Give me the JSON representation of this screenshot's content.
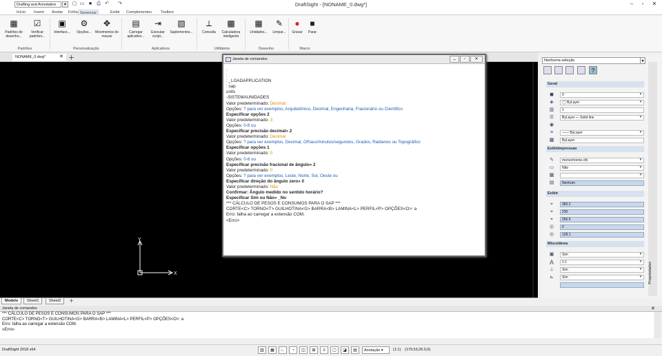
{
  "titlebar": {
    "workspace": "Drafting and Annotation",
    "title": "DraftSight - [NONAME_0.dwg*]",
    "qa_icons": [
      "new-icon",
      "open-icon",
      "save-icon",
      "print-icon",
      "undo-icon",
      "redo-icon"
    ]
  },
  "menu": {
    "tabs": [
      "Início",
      "Inserir",
      "Anotar",
      "Folha",
      "Gerenciar",
      "Exibir",
      "Complementos",
      "Toolbox"
    ],
    "active": "Gerenciar"
  },
  "ribbon": {
    "groups": [
      {
        "label": "Padrões",
        "items": [
          {
            "label": "Padrões de desenho...",
            "icon": "standards-icon"
          },
          {
            "label": "Verificar padrões...",
            "icon": "check-icon"
          }
        ]
      },
      {
        "label": "Personalização",
        "items": [
          {
            "label": "Interface...",
            "icon": "interface-icon"
          },
          {
            "label": "Opções...",
            "icon": "options-icon"
          },
          {
            "label": "Movimentos do mouse",
            "icon": "mouse-icon"
          }
        ]
      },
      {
        "label": "Aplicativos",
        "items": [
          {
            "label": "Carregar aplicativo...",
            "icon": "load-app-icon"
          },
          {
            "label": "Executar script...",
            "icon": "script-icon"
          },
          {
            "label": "Suplementos...",
            "icon": "addins-icon"
          }
        ]
      },
      {
        "label": "Utilitários",
        "items": [
          {
            "label": "Consulta",
            "icon": "query-icon"
          },
          {
            "label": "Calculadora inteligente",
            "icon": "calculator-icon"
          }
        ]
      },
      {
        "label": "Desenho",
        "items": [
          {
            "label": "Unidades...",
            "icon": "units-icon"
          },
          {
            "label": "Limpar...",
            "icon": "purge-icon"
          }
        ]
      },
      {
        "label": "Macro",
        "items": [
          {
            "label": "Gravar",
            "icon": "record-icon"
          },
          {
            "label": "Parar",
            "icon": "stop-icon"
          }
        ]
      }
    ]
  },
  "doc_tab": "NONAME_0.dwg*",
  "sheet_tabs": [
    "Modelo",
    "Sheet1",
    "Sheet2"
  ],
  "cmd_window": {
    "title": "Janela de comandos",
    "lines": [
      {
        "t": ":"
      },
      {
        "t": ":"
      },
      {
        "t": ":  _LOADAPPLICATION"
      },
      {
        "t": ":  sap"
      },
      {
        "t": "units"
      },
      {
        "t": "-SISTEMAUNIDADES"
      },
      {
        "t": "Valor predeterminado: ",
        "o": "Decimal"
      },
      {
        "t": "Opções: ",
        "b": "? para ver exemplos, Arquitetônico, Decimal, Engenharia, Fracionário ou Científico"
      },
      {
        "t": "Especificar opções 2",
        "bold": true
      },
      {
        "t": "Valor predeterminado: ",
        "o": "3"
      },
      {
        "t": "Opções: ",
        "b": "0-8 ou"
      },
      {
        "t": "Especificar precisão decimal» 2",
        "bold": true
      },
      {
        "t": "Valor predeterminado: ",
        "o": "Decimal"
      },
      {
        "t": "Opções: ",
        "b": "? para ver exemplos, Decimal, GRaus/minutos/segundos, Grados, Radianos ou Topográfico"
      },
      {
        "t": "Especificar opções 1",
        "bold": true
      },
      {
        "t": "Valor predeterminado: ",
        "o": "0"
      },
      {
        "t": "Opções: ",
        "b": "0-8 ou"
      },
      {
        "t": "Especificar precisão fracional de ângulo» 2",
        "bold": true
      },
      {
        "t": "Valor predeterminado: ",
        "o": "0"
      },
      {
        "t": "Opções: ",
        "b": "? para ver exemplos, Leste, Norte, Sul, Oeste ou"
      },
      {
        "t": "Especificar direção do ângulo zero» 0",
        "bold": true
      },
      {
        "t": "Valor predeterminado: ",
        "o": "Não"
      },
      {
        "t": "Confirmar: Ângulo medido no sentido horário?",
        "bold": true
      },
      {
        "t": "Especificar Sim ou Não» _No",
        "bold": true
      },
      {
        "t": " *** CÁLCULO DE PESOS E CONSUMOS PARA O SAP ***"
      },
      {
        "t": " CORTE<C> TORNO<T> GUILHOTINA<G> BARRA<B> LAMINA<L> PERFIL<P> OPÇÕES<O>: a"
      },
      {
        "t": " Erro: falha ao carregar a extensão COM."
      },
      {
        "t": "<Erro>"
      }
    ]
  },
  "command_panel": {
    "title": "Janela de comandos",
    "lines": [
      "*** CÁLCULO DE PESOS E CONSUMOS PARA O SAP ***",
      "CORTE<C> TORNO<T> GUILHOTINA<G> BARRA<B> LAMINA<L> PERFIL<P> OPÇÕES<O>: a",
      "Erro: falha ao carregar a extensão COM.",
      "«Erro»"
    ]
  },
  "properties": {
    "selection": "Nenhuma seleção",
    "side_label": "Propriedades",
    "sections": [
      {
        "title": "Geral",
        "rows": [
          {
            "icon": "color-icon",
            "value": "0"
          },
          {
            "icon": "layer-icon",
            "value": "◯ ByLayer"
          },
          {
            "icon": "scale-icon",
            "value": "1"
          },
          {
            "icon": "linetype-icon",
            "value": "ByLayer — Solid line"
          },
          {
            "icon": "globe-icon",
            "value": ""
          },
          {
            "icon": "lineweight-icon",
            "value": "—— ByLayer"
          },
          {
            "icon": "transparency-icon",
            "value": "ByLayer"
          }
        ]
      },
      {
        "title": "EstiloImpressao",
        "rows": [
          {
            "icon": "plotstyle-icon",
            "value": "monochrome.ctb"
          },
          {
            "icon": "plot-icon",
            "value": "Não"
          },
          {
            "icon": "table-icon",
            "value": ""
          },
          {
            "icon": "palette-icon",
            "value": "Nenhum",
            "hl": true
          }
        ]
      },
      {
        "title": "Exibir",
        "rows": [
          {
            "icon": "center-x-icon",
            "value": "383.2",
            "hl": true
          },
          {
            "icon": "center-y-icon",
            "value": "230",
            "hl": true
          },
          {
            "icon": "center-z-icon",
            "value": "256.5",
            "hl": true
          },
          {
            "icon": "height-icon",
            "value": "0",
            "hl": true
          },
          {
            "icon": "width-icon",
            "value": "128.1",
            "hl": true
          }
        ]
      },
      {
        "title": "Miscelânea",
        "rows": [
          {
            "icon": "ucs-icon",
            "value": "Sim"
          },
          {
            "icon": "text-icon",
            "value": "1:1"
          },
          {
            "icon": "ucs-origin-icon",
            "value": "Sim"
          },
          {
            "icon": "ucs-per-vp-icon",
            "value": "Sim"
          },
          {
            "icon": "blank-icon",
            "value": "",
            "hl": true
          }
        ]
      }
    ]
  },
  "statusbar": {
    "app": "DraftSight 2018 x64",
    "annotation": "Anotação",
    "scale": "(1:1)",
    "coords": "(179.53,26.0,0)"
  },
  "colors": {
    "accent": "#1c5bb0",
    "default_value": "#e08a00",
    "canvas": "#000000"
  }
}
